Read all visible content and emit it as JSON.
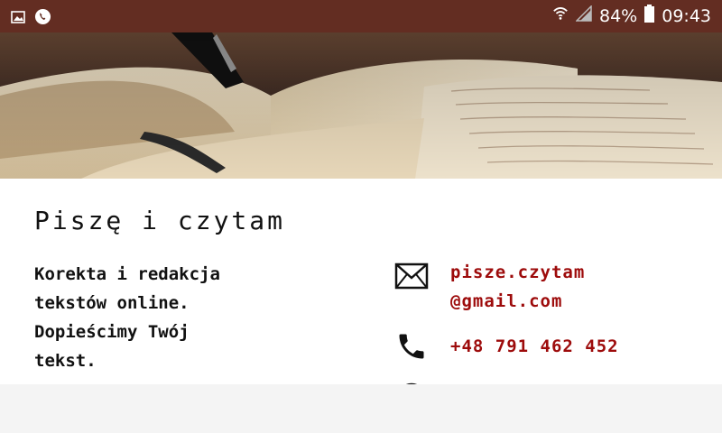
{
  "status_bar": {
    "left_icons": [
      "image-icon",
      "phone-call-icon"
    ],
    "right_icons": [
      "wifi-icon",
      "signal-icon",
      "battery-icon"
    ],
    "battery": "84%",
    "time": "09:43"
  },
  "hero": {
    "image": "open-books-photo"
  },
  "card": {
    "title": "Piszę i czytam",
    "description_lines": [
      "Korekta i redakcja",
      "tekstów online.",
      "Dopieścimy Twój",
      "tekst."
    ],
    "email_lines": [
      "pisze.czytam",
      "@gmail.com"
    ],
    "phone": "+48 791 462 452"
  },
  "colors": {
    "status_bar": "#632d22",
    "link": "#9d0b0b",
    "text": "#111111"
  }
}
